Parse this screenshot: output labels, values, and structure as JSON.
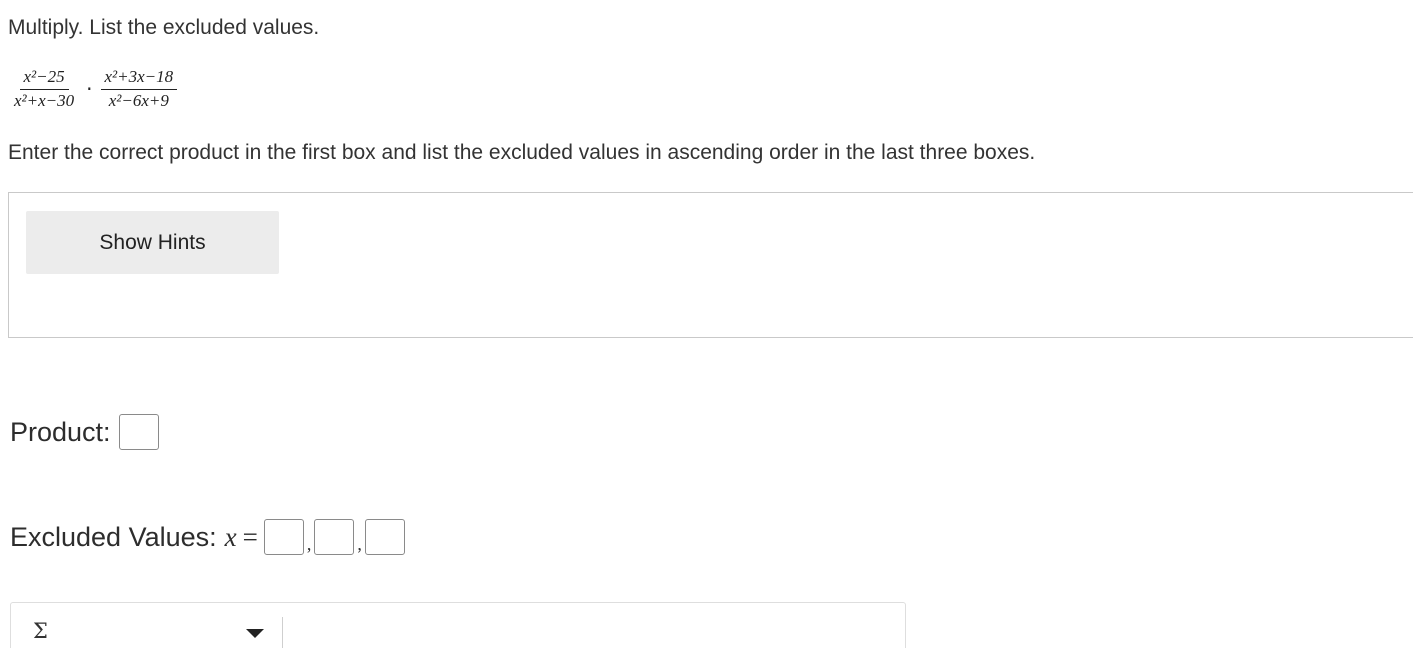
{
  "question": {
    "instruction": "Multiply. List the excluded values.",
    "directions": "Enter the correct product in the first box and list the excluded values in ascending order in the last three boxes."
  },
  "expression": {
    "fraction1": {
      "numerator": "x²−25",
      "denominator": "x²+x−30"
    },
    "operator": "·",
    "fraction2": {
      "numerator": "x²+3x−18",
      "denominator": "x²−6x+9"
    }
  },
  "hints": {
    "button_label": "Show Hints"
  },
  "product": {
    "label": "Product:",
    "value": ""
  },
  "excluded": {
    "label": "Excluded Values:",
    "variable": "x",
    "equals": "=",
    "separator": ",",
    "values": [
      "",
      "",
      ""
    ]
  },
  "editor": {
    "symbol": "Σ",
    "icon": "sigma-icon",
    "dropdown_icon": "caret-down-icon"
  }
}
